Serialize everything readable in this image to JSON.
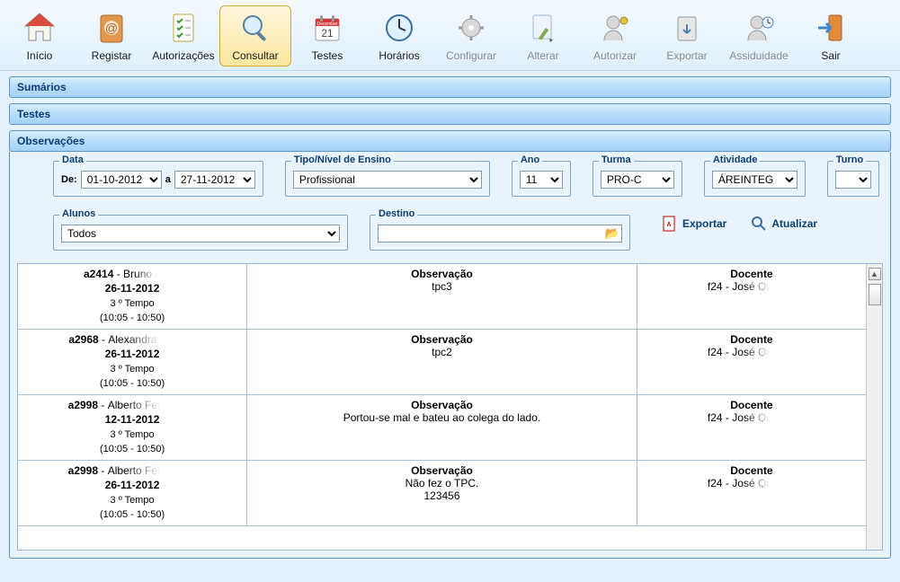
{
  "toolbar": {
    "inicio": "Início",
    "registar": "Registar",
    "autorizacoes": "Autorizações",
    "consultar": "Consultar",
    "testes": "Testes",
    "horarios": "Horários",
    "configurar": "Configurar",
    "alterar": "Alterar",
    "autorizar": "Autorizar",
    "exportar": "Exportar",
    "assiduidade": "Assiduidade",
    "sair": "Sair"
  },
  "panels": {
    "sumarios": "Sumários",
    "testes": "Testes",
    "observacoes": "Observações"
  },
  "filters": {
    "data": {
      "legend": "Data",
      "de_lbl": "De:",
      "de": "01-10-2012",
      "a_lbl": "a",
      "a": "27-11-2012"
    },
    "tipo": {
      "legend": "Tipo/Nível de Ensino",
      "value": "Profissional"
    },
    "ano": {
      "legend": "Ano",
      "value": "11"
    },
    "turma": {
      "legend": "Turma",
      "value": "PRO-C"
    },
    "atividade": {
      "legend": "Atividade",
      "value": "ÁREINTEG"
    },
    "turno": {
      "legend": "Turno",
      "value": ""
    },
    "alunos": {
      "legend": "Alunos",
      "value": "Todos"
    },
    "destino": {
      "legend": "Destino",
      "value": ""
    }
  },
  "actions": {
    "exportar": "Exportar",
    "atualizar": "Atualizar"
  },
  "grid": {
    "head_obs": "Observação",
    "head_docente": "Docente",
    "rows": [
      {
        "aluno_id": "a2414",
        "aluno_nome": "Bruno Alves",
        "date": "26-11-2012",
        "tempo": "3 º Tempo",
        "hora": "(10:05 - 10:50)",
        "obs": "tpc3",
        "obs2": "",
        "docente_id": "f24",
        "docente_nome": "José Queirós"
      },
      {
        "aluno_id": "a2968",
        "aluno_nome": "Alexandra Peixoto",
        "date": "26-11-2012",
        "tempo": "3 º Tempo",
        "hora": "(10:05 - 10:50)",
        "obs": "tpc2",
        "obs2": "",
        "docente_id": "f24",
        "docente_nome": "José Queirós"
      },
      {
        "aluno_id": "a2998",
        "aluno_nome": "Alberto Fernandes",
        "date": "12-11-2012",
        "tempo": "3 º Tempo",
        "hora": "(10:05 - 10:50)",
        "obs": "Portou-se mal e bateu ao colega do lado.",
        "obs2": "",
        "docente_id": "f24",
        "docente_nome": "José Queirós"
      },
      {
        "aluno_id": "a2998",
        "aluno_nome": "Alberto Fernandes",
        "date": "26-11-2012",
        "tempo": "3 º Tempo",
        "hora": "(10:05 - 10:50)",
        "obs": "Não fez o TPC.",
        "obs2": "123456",
        "docente_id": "f24",
        "docente_nome": "José Queirós"
      }
    ]
  }
}
